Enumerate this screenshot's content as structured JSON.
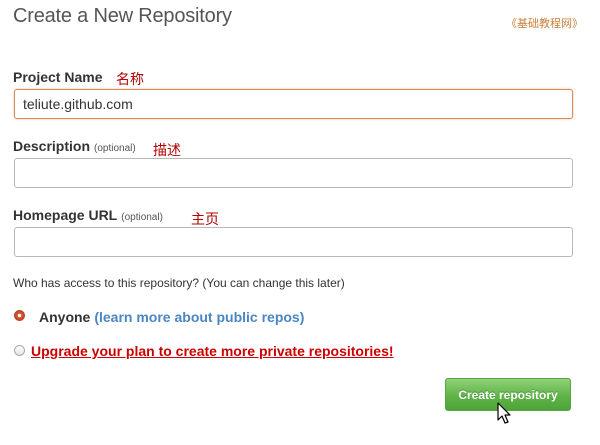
{
  "page": {
    "title": "Create a New Repository",
    "watermark": "《基础教程网》"
  },
  "form": {
    "project_name": {
      "label": "Project Name",
      "annotation": "名称",
      "value": "teliute.github.com"
    },
    "description": {
      "label": "Description",
      "optional": "(optional)",
      "annotation": "描述",
      "value": ""
    },
    "homepage": {
      "label": "Homepage URL",
      "optional": "(optional)",
      "annotation": "主页",
      "value": ""
    }
  },
  "access": {
    "question": "Who has access to this repository? (You can change this later)",
    "anyone_label": "Anyone",
    "learn_more": "(learn more about public repos)",
    "upgrade_link": "Upgrade your plan to create more private repositories!",
    "selected": "anyone"
  },
  "actions": {
    "create_label": "Create repository"
  },
  "colors": {
    "accent_orange": "#d98c5a",
    "link_blue": "#4b86c4",
    "warning_red": "#cc0000",
    "button_green": "#5fb448"
  },
  "icons": {
    "cursor": "mouse-pointer-icon"
  }
}
